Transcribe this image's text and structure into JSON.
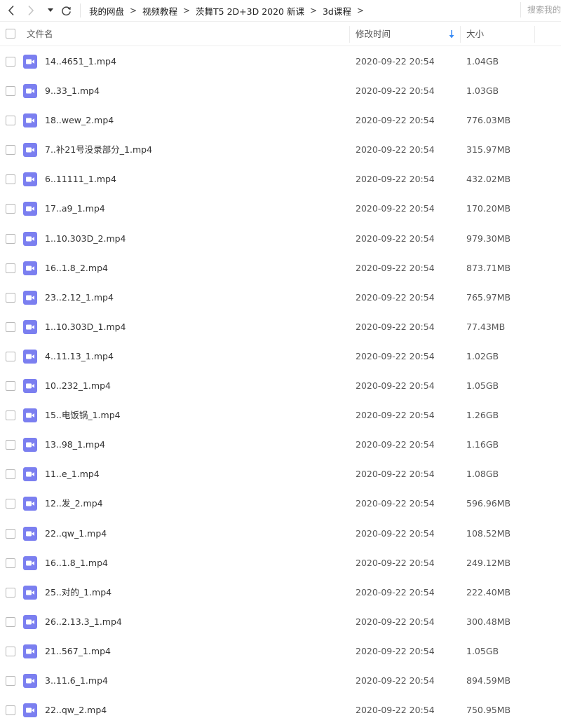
{
  "nav": {
    "breadcrumb": [
      "我的网盘",
      "视频教程",
      "茨舞T5 2D+3D 2020 新课",
      "3d课程"
    ],
    "separator": ">",
    "search_placeholder": "搜索我的"
  },
  "columns": {
    "name": "文件名",
    "modified": "修改时间",
    "size": "大小"
  },
  "sort": {
    "column": "modified",
    "direction": "descending"
  },
  "colors": {
    "accent": "#3b8cf5",
    "video_icon": "#7b7ff0",
    "video_icon_dark": "#5d62e0"
  },
  "files": [
    {
      "name": "14..4651_1.mp4",
      "modified": "2020-09-22 20:54",
      "size": "1.04GB"
    },
    {
      "name": "9..33_1.mp4",
      "modified": "2020-09-22 20:54",
      "size": "1.03GB"
    },
    {
      "name": "18..wew_2.mp4",
      "modified": "2020-09-22 20:54",
      "size": "776.03MB"
    },
    {
      "name": "7..补21号没录部分_1.mp4",
      "modified": "2020-09-22 20:54",
      "size": "315.97MB"
    },
    {
      "name": "6..11111_1.mp4",
      "modified": "2020-09-22 20:54",
      "size": "432.02MB"
    },
    {
      "name": "17..a9_1.mp4",
      "modified": "2020-09-22 20:54",
      "size": "170.20MB"
    },
    {
      "name": "1..10.303D_2.mp4",
      "modified": "2020-09-22 20:54",
      "size": "979.30MB"
    },
    {
      "name": "16..1.8_2.mp4",
      "modified": "2020-09-22 20:54",
      "size": "873.71MB"
    },
    {
      "name": "23..2.12_1.mp4",
      "modified": "2020-09-22 20:54",
      "size": "765.97MB"
    },
    {
      "name": "1..10.303D_1.mp4",
      "modified": "2020-09-22 20:54",
      "size": "77.43MB"
    },
    {
      "name": "4..11.13_1.mp4",
      "modified": "2020-09-22 20:54",
      "size": "1.02GB"
    },
    {
      "name": "10..232_1.mp4",
      "modified": "2020-09-22 20:54",
      "size": "1.05GB"
    },
    {
      "name": "15..电饭锅_1.mp4",
      "modified": "2020-09-22 20:54",
      "size": "1.26GB"
    },
    {
      "name": "13..98_1.mp4",
      "modified": "2020-09-22 20:54",
      "size": "1.16GB"
    },
    {
      "name": "11..e_1.mp4",
      "modified": "2020-09-22 20:54",
      "size": "1.08GB"
    },
    {
      "name": "12..发_2.mp4",
      "modified": "2020-09-22 20:54",
      "size": "596.96MB"
    },
    {
      "name": "22..qw_1.mp4",
      "modified": "2020-09-22 20:54",
      "size": "108.52MB"
    },
    {
      "name": "16..1.8_1.mp4",
      "modified": "2020-09-22 20:54",
      "size": "249.12MB"
    },
    {
      "name": "25..对的_1.mp4",
      "modified": "2020-09-22 20:54",
      "size": "222.40MB"
    },
    {
      "name": "26..2.13.3_1.mp4",
      "modified": "2020-09-22 20:54",
      "size": "300.48MB"
    },
    {
      "name": "21..567_1.mp4",
      "modified": "2020-09-22 20:54",
      "size": "1.05GB"
    },
    {
      "name": "3..11.6_1.mp4",
      "modified": "2020-09-22 20:54",
      "size": "894.59MB"
    },
    {
      "name": "22..qw_2.mp4",
      "modified": "2020-09-22 20:54",
      "size": "750.95MB"
    }
  ]
}
